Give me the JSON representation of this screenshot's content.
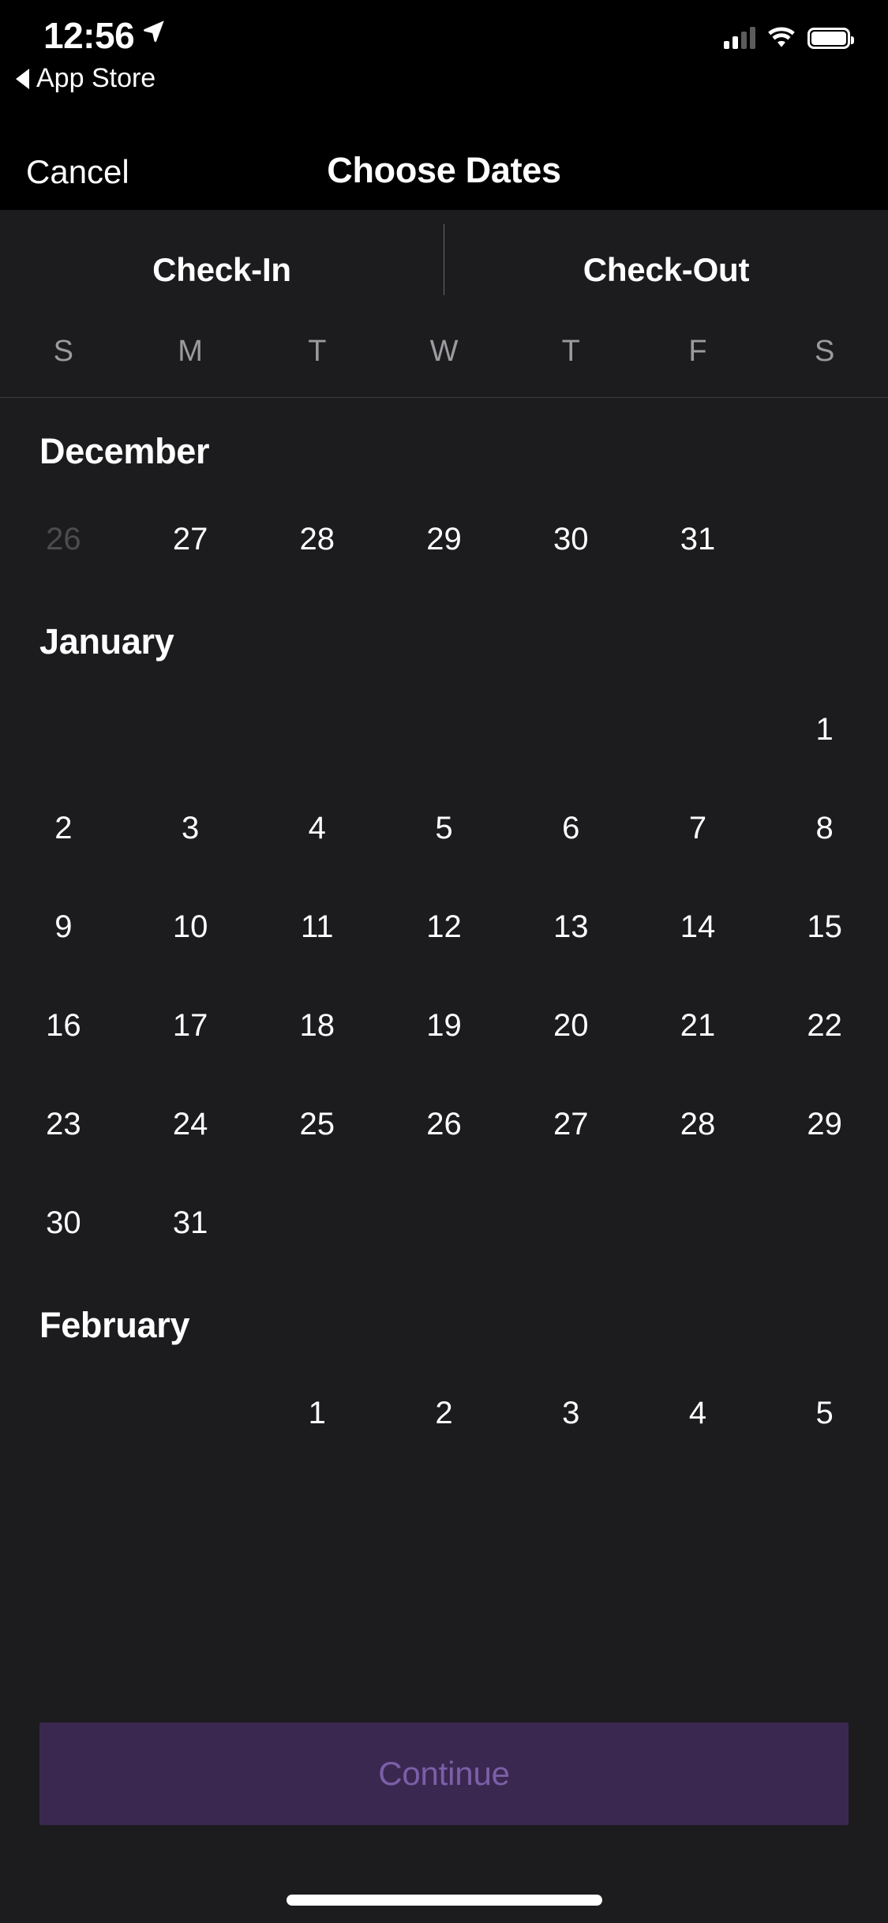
{
  "status_bar": {
    "time": "12:56",
    "location_icon": "location-arrow-icon",
    "back_link": "App Store",
    "back_icon": "back-triangle-icon",
    "signal_icon": "cellular-bars-icon",
    "wifi_icon": "wifi-icon",
    "battery_icon": "battery-full-icon"
  },
  "nav": {
    "cancel_label": "Cancel",
    "title": "Choose Dates"
  },
  "tabs": {
    "check_in_label": "Check-In",
    "check_out_label": "Check-Out"
  },
  "weekdays": [
    "S",
    "M",
    "T",
    "W",
    "T",
    "F",
    "S"
  ],
  "calendar": {
    "months": [
      {
        "name": "December",
        "weeks": [
          [
            {
              "day": "26",
              "state": "disabled"
            },
            {
              "day": "27",
              "state": "default"
            },
            {
              "day": "28",
              "state": "default"
            },
            {
              "day": "29",
              "state": "default"
            },
            {
              "day": "30",
              "state": "default"
            },
            {
              "day": "31",
              "state": "default"
            },
            {
              "day": "",
              "state": "empty"
            }
          ]
        ]
      },
      {
        "name": "January",
        "weeks": [
          [
            {
              "day": "",
              "state": "empty"
            },
            {
              "day": "",
              "state": "empty"
            },
            {
              "day": "",
              "state": "empty"
            },
            {
              "day": "",
              "state": "empty"
            },
            {
              "day": "",
              "state": "empty"
            },
            {
              "day": "",
              "state": "empty"
            },
            {
              "day": "1",
              "state": "default"
            }
          ],
          [
            {
              "day": "2",
              "state": "default"
            },
            {
              "day": "3",
              "state": "default"
            },
            {
              "day": "4",
              "state": "default"
            },
            {
              "day": "5",
              "state": "default"
            },
            {
              "day": "6",
              "state": "default"
            },
            {
              "day": "7",
              "state": "default"
            },
            {
              "day": "8",
              "state": "default"
            }
          ],
          [
            {
              "day": "9",
              "state": "default"
            },
            {
              "day": "10",
              "state": "default"
            },
            {
              "day": "11",
              "state": "default"
            },
            {
              "day": "12",
              "state": "default"
            },
            {
              "day": "13",
              "state": "default"
            },
            {
              "day": "14",
              "state": "default"
            },
            {
              "day": "15",
              "state": "default"
            }
          ],
          [
            {
              "day": "16",
              "state": "default"
            },
            {
              "day": "17",
              "state": "default"
            },
            {
              "day": "18",
              "state": "default"
            },
            {
              "day": "19",
              "state": "default"
            },
            {
              "day": "20",
              "state": "default"
            },
            {
              "day": "21",
              "state": "default"
            },
            {
              "day": "22",
              "state": "default"
            }
          ],
          [
            {
              "day": "23",
              "state": "default"
            },
            {
              "day": "24",
              "state": "default"
            },
            {
              "day": "25",
              "state": "default"
            },
            {
              "day": "26",
              "state": "default"
            },
            {
              "day": "27",
              "state": "default"
            },
            {
              "day": "28",
              "state": "default"
            },
            {
              "day": "29",
              "state": "default"
            }
          ],
          [
            {
              "day": "30",
              "state": "default"
            },
            {
              "day": "31",
              "state": "default"
            },
            {
              "day": "",
              "state": "empty"
            },
            {
              "day": "",
              "state": "empty"
            },
            {
              "day": "",
              "state": "empty"
            },
            {
              "day": "",
              "state": "empty"
            },
            {
              "day": "",
              "state": "empty"
            }
          ]
        ]
      },
      {
        "name": "February",
        "weeks": [
          [
            {
              "day": "",
              "state": "empty"
            },
            {
              "day": "",
              "state": "empty"
            },
            {
              "day": "1",
              "state": "default"
            },
            {
              "day": "2",
              "state": "default"
            },
            {
              "day": "3",
              "state": "default"
            },
            {
              "day": "4",
              "state": "default"
            },
            {
              "day": "5",
              "state": "default"
            }
          ]
        ]
      }
    ]
  },
  "cta": {
    "continue_label": "Continue"
  },
  "colors": {
    "background": "#1c1c1e",
    "bar_background": "#000000",
    "cta_background": "#3b2850",
    "cta_text": "#7b5fa8",
    "muted_text": "#9b9b9f",
    "disabled_day": "#4c4c4f"
  }
}
